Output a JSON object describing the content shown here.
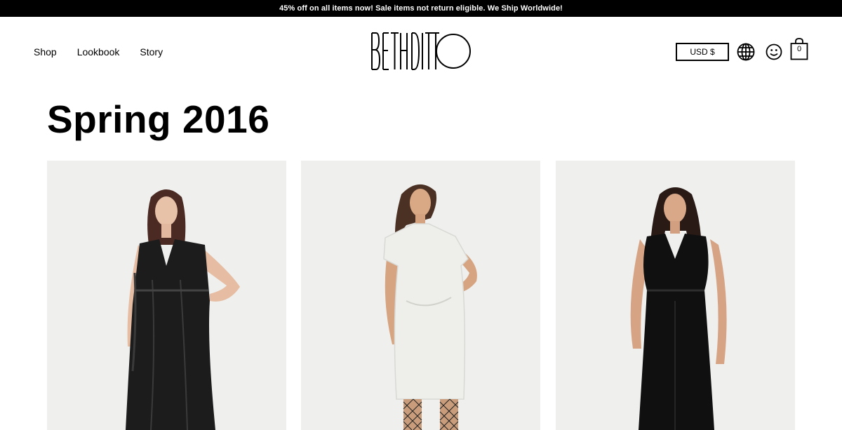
{
  "announcement": "45% off on all items now! Sale items not return eligible. We Ship Worldwide!",
  "nav": {
    "items": [
      {
        "label": "Shop"
      },
      {
        "label": "Lookbook"
      },
      {
        "label": "Story"
      }
    ]
  },
  "brand": {
    "logo_text": "BETH DITTO"
  },
  "header_actions": {
    "currency": "USD $",
    "cart_count": "0",
    "icons": [
      "globe-icon",
      "smiley-icon",
      "shopping-bag-icon"
    ]
  },
  "page": {
    "title": "Spring 2016"
  },
  "products": [
    {
      "image": "model-black-metallic-jumpsuit",
      "outfit_color": "#1c1c1c"
    },
    {
      "image": "model-white-dress-fishnets",
      "outfit_color": "#eeeeea"
    },
    {
      "image": "model-black-jumpsuit",
      "outfit_color": "#101010"
    }
  ],
  "colors": {
    "announcement_bg": "#000000",
    "card_bg": "#efefee",
    "page_bg": "#ffffff"
  }
}
